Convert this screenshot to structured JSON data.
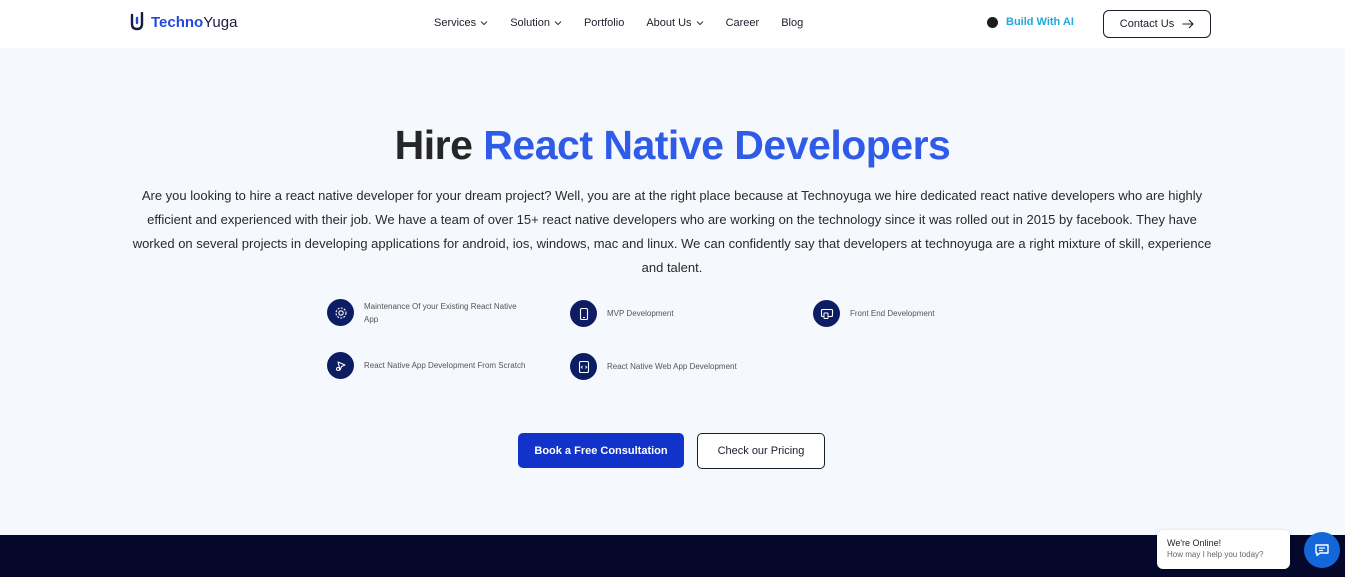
{
  "brand": {
    "name_bold": "Techno",
    "name_regular": "Yuga"
  },
  "nav": {
    "items": [
      {
        "label": "Services",
        "dropdown": true
      },
      {
        "label": "Solution",
        "dropdown": true
      },
      {
        "label": "Portfolio",
        "dropdown": false
      },
      {
        "label": "About Us",
        "dropdown": true
      },
      {
        "label": "Career",
        "dropdown": false
      },
      {
        "label": "Blog",
        "dropdown": false
      }
    ],
    "build_ai": "Build With AI",
    "contact": "Contact Us"
  },
  "hero": {
    "title_dark": "Hire",
    "title_blue": "React Native Developers",
    "description": "Are you looking to hire a react native developer for your dream project? Well, you are at the right place because at Technoyuga we hire dedicated react native developers who are highly efficient and experienced with their job. We have a team of over 15+ react native developers who are working on the technology since it was rolled out in 2015 by facebook. They have worked on several projects in developing applications for android, ios, windows, mac and linux. We can confidently say that developers at technoyuga are a right mixture of skill, experience and talent."
  },
  "features": [
    {
      "label": "Maintenance Of your Existing React Native App",
      "icon": "gear-icon"
    },
    {
      "label": "MVP Development",
      "icon": "mobile-icon"
    },
    {
      "label": "Front End Development",
      "icon": "monitor-icon"
    },
    {
      "label": "React Native App Development From Scratch",
      "icon": "cursor-icon"
    },
    {
      "label": "React Native Web App Development",
      "icon": "code-icon"
    }
  ],
  "buttons": {
    "primary": "Book a Free Consultation",
    "secondary": "Check our Pricing"
  },
  "chat": {
    "title": "We're Online!",
    "subtitle": "How may I help you today?"
  },
  "colors": {
    "accent_blue": "#2f5be8",
    "primary_button": "#1133c9",
    "icon_navy": "#0d1d63",
    "ai_cyan": "#20a9d8",
    "dark_band": "#05082b"
  }
}
